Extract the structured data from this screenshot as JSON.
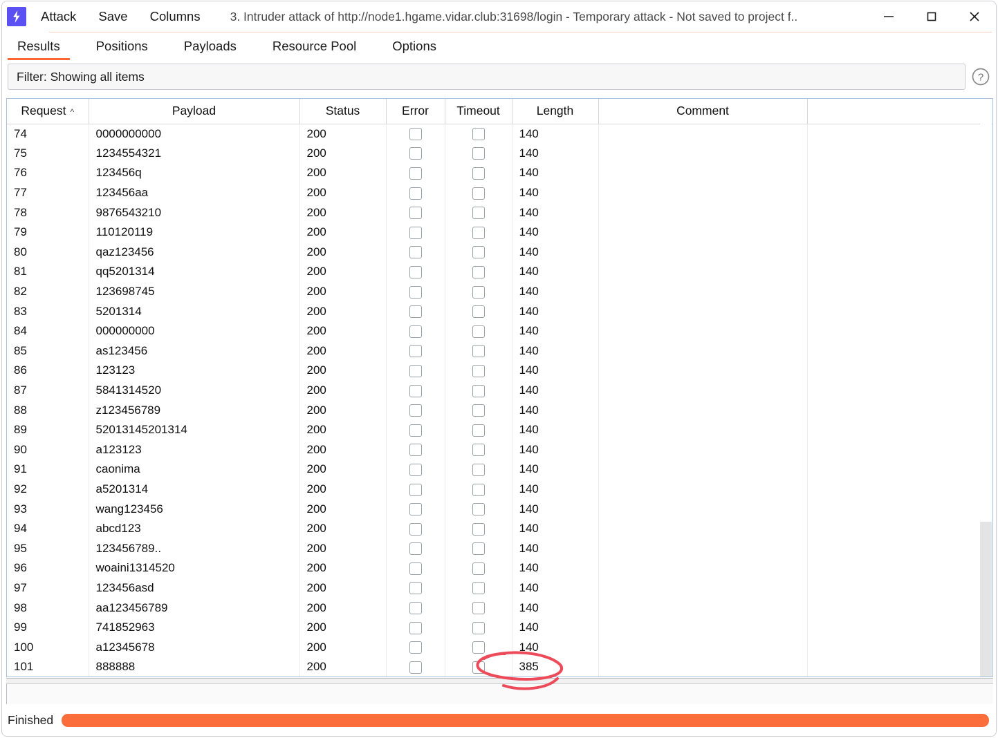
{
  "window": {
    "title": "3. Intruder attack of http://node1.hgame.vidar.club:31698/login - Temporary attack - Not saved to project f..",
    "logo_icon": "burp-lightning-icon",
    "controls": {
      "minimize": "minimize-icon",
      "maximize": "maximize-icon",
      "close": "close-icon"
    }
  },
  "menubar": {
    "items": [
      {
        "label": "Attack"
      },
      {
        "label": "Save"
      },
      {
        "label": "Columns"
      }
    ]
  },
  "tabs": {
    "active": "Results",
    "items": [
      {
        "label": "Results"
      },
      {
        "label": "Positions"
      },
      {
        "label": "Payloads"
      },
      {
        "label": "Resource Pool"
      },
      {
        "label": "Options"
      }
    ]
  },
  "filter": {
    "text": "Filter: Showing all items",
    "help_icon": "help-question-icon"
  },
  "table": {
    "sort_column": "Request",
    "sort_direction": "ascending",
    "sort_icon": "sort-ascending-icon",
    "columns": [
      "Request",
      "Payload",
      "Status",
      "Error",
      "Timeout",
      "Length",
      "Comment",
      ""
    ],
    "rows": [
      {
        "request": "74",
        "payload": "0000000000",
        "status": "200",
        "error": false,
        "timeout": false,
        "length": "140",
        "comment": ""
      },
      {
        "request": "75",
        "payload": "1234554321",
        "status": "200",
        "error": false,
        "timeout": false,
        "length": "140",
        "comment": ""
      },
      {
        "request": "76",
        "payload": "123456q",
        "status": "200",
        "error": false,
        "timeout": false,
        "length": "140",
        "comment": ""
      },
      {
        "request": "77",
        "payload": "123456aa",
        "status": "200",
        "error": false,
        "timeout": false,
        "length": "140",
        "comment": ""
      },
      {
        "request": "78",
        "payload": "9876543210",
        "status": "200",
        "error": false,
        "timeout": false,
        "length": "140",
        "comment": ""
      },
      {
        "request": "79",
        "payload": "110120119",
        "status": "200",
        "error": false,
        "timeout": false,
        "length": "140",
        "comment": ""
      },
      {
        "request": "80",
        "payload": "qaz123456",
        "status": "200",
        "error": false,
        "timeout": false,
        "length": "140",
        "comment": ""
      },
      {
        "request": "81",
        "payload": "qq5201314",
        "status": "200",
        "error": false,
        "timeout": false,
        "length": "140",
        "comment": ""
      },
      {
        "request": "82",
        "payload": "123698745",
        "status": "200",
        "error": false,
        "timeout": false,
        "length": "140",
        "comment": ""
      },
      {
        "request": "83",
        "payload": "5201314",
        "status": "200",
        "error": false,
        "timeout": false,
        "length": "140",
        "comment": ""
      },
      {
        "request": "84",
        "payload": "000000000",
        "status": "200",
        "error": false,
        "timeout": false,
        "length": "140",
        "comment": ""
      },
      {
        "request": "85",
        "payload": "as123456",
        "status": "200",
        "error": false,
        "timeout": false,
        "length": "140",
        "comment": ""
      },
      {
        "request": "86",
        "payload": "123123",
        "status": "200",
        "error": false,
        "timeout": false,
        "length": "140",
        "comment": ""
      },
      {
        "request": "87",
        "payload": "5841314520",
        "status": "200",
        "error": false,
        "timeout": false,
        "length": "140",
        "comment": ""
      },
      {
        "request": "88",
        "payload": "z123456789",
        "status": "200",
        "error": false,
        "timeout": false,
        "length": "140",
        "comment": ""
      },
      {
        "request": "89",
        "payload": "52013145201314",
        "status": "200",
        "error": false,
        "timeout": false,
        "length": "140",
        "comment": ""
      },
      {
        "request": "90",
        "payload": "a123123",
        "status": "200",
        "error": false,
        "timeout": false,
        "length": "140",
        "comment": ""
      },
      {
        "request": "91",
        "payload": "caonima",
        "status": "200",
        "error": false,
        "timeout": false,
        "length": "140",
        "comment": ""
      },
      {
        "request": "92",
        "payload": "a5201314",
        "status": "200",
        "error": false,
        "timeout": false,
        "length": "140",
        "comment": ""
      },
      {
        "request": "93",
        "payload": "wang123456",
        "status": "200",
        "error": false,
        "timeout": false,
        "length": "140",
        "comment": ""
      },
      {
        "request": "94",
        "payload": "abcd123",
        "status": "200",
        "error": false,
        "timeout": false,
        "length": "140",
        "comment": ""
      },
      {
        "request": "95",
        "payload": "123456789..",
        "status": "200",
        "error": false,
        "timeout": false,
        "length": "140",
        "comment": ""
      },
      {
        "request": "96",
        "payload": "woaini1314520",
        "status": "200",
        "error": false,
        "timeout": false,
        "length": "140",
        "comment": ""
      },
      {
        "request": "97",
        "payload": "123456asd",
        "status": "200",
        "error": false,
        "timeout": false,
        "length": "140",
        "comment": ""
      },
      {
        "request": "98",
        "payload": "aa123456789",
        "status": "200",
        "error": false,
        "timeout": false,
        "length": "140",
        "comment": ""
      },
      {
        "request": "99",
        "payload": "741852963",
        "status": "200",
        "error": false,
        "timeout": false,
        "length": "140",
        "comment": ""
      },
      {
        "request": "100",
        "payload": "a12345678",
        "status": "200",
        "error": false,
        "timeout": false,
        "length": "140",
        "comment": ""
      },
      {
        "request": "101",
        "payload": "888888",
        "status": "200",
        "error": false,
        "timeout": false,
        "length": "385",
        "comment": ""
      }
    ]
  },
  "annotation": {
    "shape": "hand-drawn-red-ellipse",
    "color": "#ed4a5a",
    "targets": "length value 385 on request 101"
  },
  "statusbar": {
    "text": "Finished",
    "progress_percent": 100,
    "progress_color": "#fb6d3a"
  }
}
